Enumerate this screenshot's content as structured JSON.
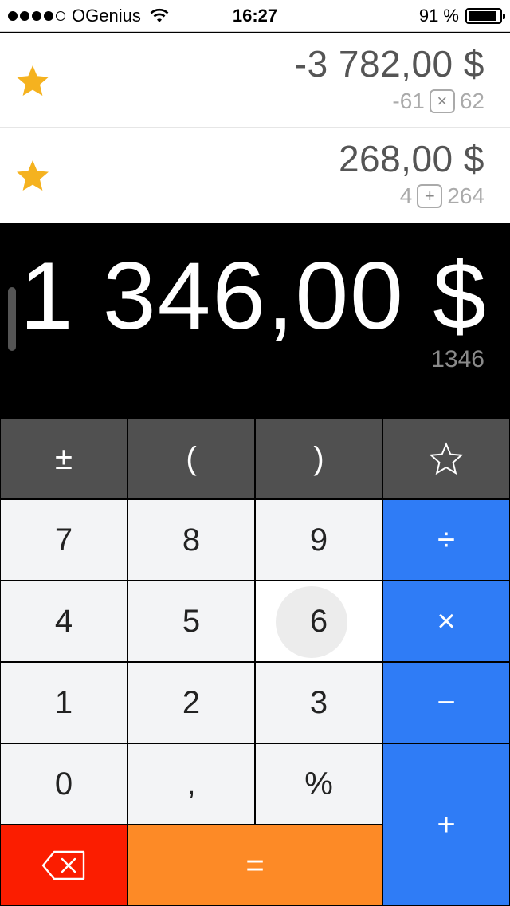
{
  "status": {
    "carrier": "OGenius",
    "time": "16:27",
    "battery_pct": "91 %",
    "battery_level": 0.91,
    "signal_bars_filled": 4,
    "signal_bars_total": 5
  },
  "history": [
    {
      "result": "-3 782,00 $",
      "operand1": "-61",
      "operator": "×",
      "operand2": "62",
      "favorite": true
    },
    {
      "result": "268,00 $",
      "operand1": "4",
      "operator": "+",
      "operand2": "264",
      "favorite": true
    }
  ],
  "display": {
    "value": "1 346,00 $",
    "raw": "1346"
  },
  "keys": {
    "plus_minus": "±",
    "open_paren": "(",
    "close_paren": ")",
    "favorite_icon": "star-outline-icon",
    "seven": "7",
    "eight": "8",
    "nine": "9",
    "divide": "÷",
    "four": "4",
    "five": "5",
    "six": "6",
    "multiply": "×",
    "one": "1",
    "two": "2",
    "three": "3",
    "minus": "−",
    "zero": "0",
    "comma": ",",
    "percent": "%",
    "plus": "+",
    "backspace_icon": "backspace-icon",
    "equals": "="
  },
  "colors": {
    "operator_blue": "#2f7cf6",
    "delete_red": "#fb1d00",
    "equals_orange": "#fd8a26",
    "star_gold": "#f5b21f",
    "function_gray": "#505050"
  }
}
